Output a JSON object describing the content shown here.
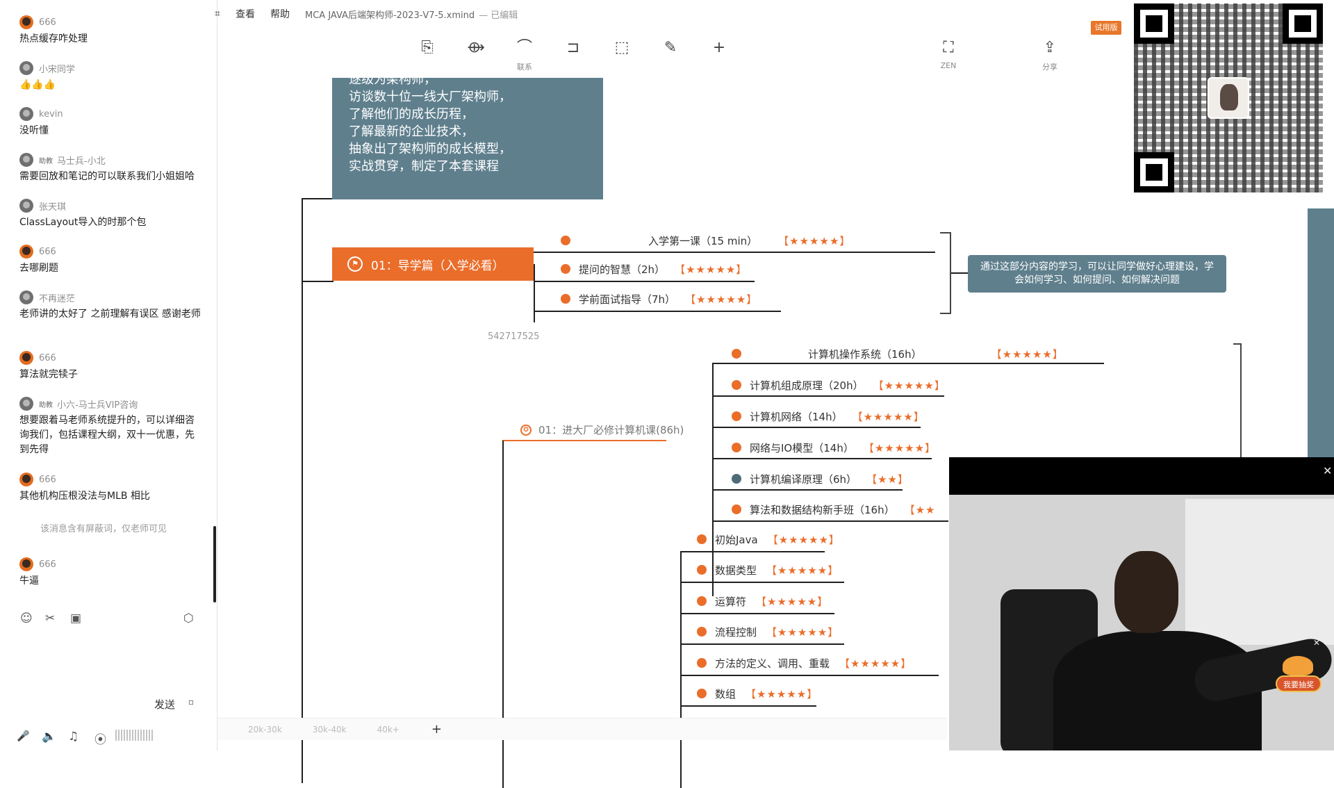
{
  "chat": {
    "messages": [
      {
        "user": "666",
        "text": "热点缓存咋处理",
        "avatar": "fire"
      },
      {
        "user": "小宋同学",
        "text": "👍👍👍",
        "avatar": "grey"
      },
      {
        "user": "kevin",
        "text": "没听懂",
        "avatar": "grey"
      },
      {
        "badge": "助教",
        "user": "马士兵-小北",
        "text": "需要回放和笔记的可以联系我们小姐姐哈",
        "avatar": "grey"
      },
      {
        "user": "张天琪",
        "text": "ClassLayout导入的时那个包",
        "avatar": "grey"
      },
      {
        "user": "666",
        "text": "去哪刷题",
        "avatar": "fire"
      },
      {
        "user": "不再迷茫",
        "text": "老师讲的太好了 之前理解有误区 感谢老师",
        "avatar": "grey"
      },
      {
        "user": "666",
        "text": "算法就完犊子",
        "avatar": "fire"
      },
      {
        "badge": "助教",
        "user": "小六-马士兵VIP咨询",
        "text": "想要跟着马老师系统提升的，可以详细咨询我们，包括课程大纲，双十一优惠，先到先得",
        "avatar": "grey"
      },
      {
        "user": "666",
        "text": "其他机构压根没法与MLB 相比",
        "avatar": "fire"
      },
      {
        "user": "666",
        "text": "牛逼",
        "avatar": "fire"
      }
    ],
    "hidden_notice": "该消息含有屏蔽词，仅老师可见",
    "send_label": "发送",
    "send_more": "▫",
    "tool_icons": {
      "emoji": "☺",
      "scissors": "✂",
      "image": "▣",
      "settings": "⬡",
      "mic": "🎤",
      "speaker": "🔈",
      "music": "♫",
      "location": "⦿"
    }
  },
  "menubar": {
    "cut_item": "⌗",
    "view": "查看",
    "help": "帮助",
    "filename": "MCA JAVA后端架构师-2023-V7-5.xmind",
    "status": "— 已编辑",
    "trial_badge": "试用版"
  },
  "toolbar": [
    {
      "icon": "⎘",
      "label": ""
    },
    {
      "icon": "⟴",
      "label": ""
    },
    {
      "icon": "⌒",
      "label": "联系"
    },
    {
      "icon": "⊐",
      "label": ""
    },
    {
      "icon": "⬚",
      "label": ""
    },
    {
      "icon": "✎",
      "label": ""
    },
    {
      "icon": "+",
      "label": ""
    },
    {
      "icon": "⛶",
      "label": "ZEN"
    },
    {
      "icon": "⇪",
      "label": "分享"
    }
  ],
  "mindmap": {
    "intro_lines": [
      "逐级为架构师，",
      "访谈数十位一线大厂架构师，",
      "了解他们的成长历程，",
      "了解最新的企业技术，",
      "抽象出了架构师的成长模型，",
      "实战贯穿，制定了本套课程"
    ],
    "section1": {
      "title": "01：导学篇（入学必看）",
      "items": [
        {
          "label": "入学第一课（15 min）",
          "stars": "【★★★★★】"
        },
        {
          "label": "提问的智慧（2h）",
          "stars": "【★★★★★】"
        },
        {
          "label": "学前面试指导（7h）",
          "stars": "【★★★★★】"
        }
      ],
      "note": "通过这部分内容的学习，可以让同学做好心理建设，学会如何学习、如何提问、如何解决问题"
    },
    "id_text": "542717525",
    "section2": {
      "title": "01：进大厂必修计算机课(86h)",
      "items": [
        {
          "label": "计算机操作系统（16h）",
          "stars": "【★★★★★】",
          "dot": "orange"
        },
        {
          "label": "计算机组成原理（20h）",
          "stars": "【★★★★★】",
          "dot": "orange"
        },
        {
          "label": "计算机网络（14h）",
          "stars": "【★★★★★】",
          "dot": "orange"
        },
        {
          "label": "网络与IO模型（14h）",
          "stars": "【★★★★★】",
          "dot": "orange"
        },
        {
          "label": "计算机编译原理（6h）",
          "stars": "【★★】",
          "dot": "blue"
        },
        {
          "label": "算法和数据结构新手班（16h）",
          "stars": "【★★",
          "dot": "orange"
        }
      ]
    },
    "section3": {
      "items": [
        {
          "label": "初始Java",
          "stars": "【★★★★★】"
        },
        {
          "label": "数据类型",
          "stars": "【★★★★★】"
        },
        {
          "label": "运算符",
          "stars": "【★★★★★】"
        },
        {
          "label": "流程控制",
          "stars": "【★★★★★】"
        },
        {
          "label": "方法的定义、调用、重载",
          "stars": "【★★★★★】"
        },
        {
          "label": "数组",
          "stars": "【★★★★★】"
        }
      ]
    }
  },
  "bottombar": {
    "tabs": [
      "20k-30k",
      "30k-40k",
      "40k+"
    ],
    "add": "+"
  },
  "video": {
    "close": "✕",
    "lottery": "我要抽奖",
    "lottery_close": "✕"
  },
  "colors": {
    "accent": "#ea6d2a",
    "node_fill": "#5f7f8d"
  }
}
